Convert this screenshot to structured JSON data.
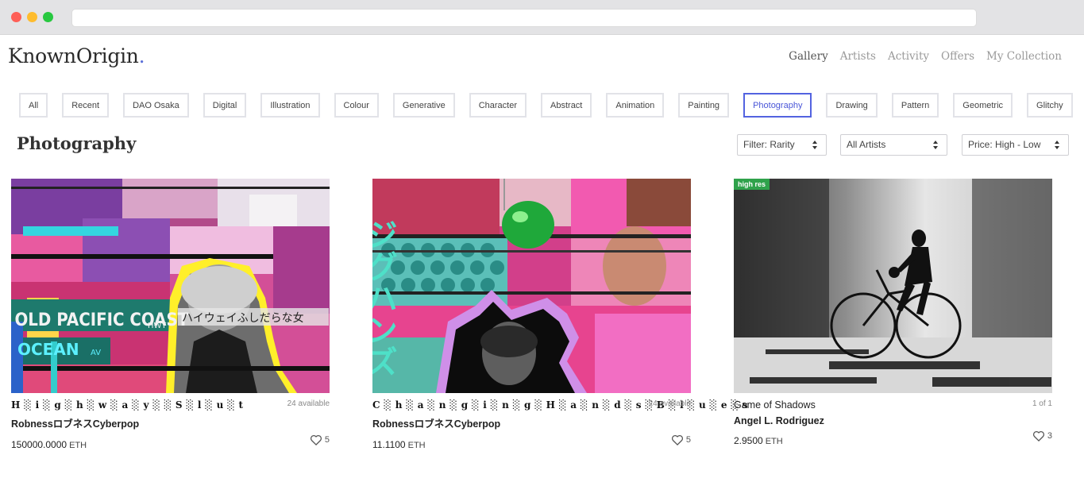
{
  "header": {
    "logo_text": "KnownOrigin",
    "logo_dot": ".",
    "nav": [
      "Gallery",
      "Artists",
      "Activity",
      "Offers",
      "My Collection"
    ],
    "active_nav": "Gallery"
  },
  "categories": [
    "All",
    "Recent",
    "DAO Osaka",
    "Digital",
    "Illustration",
    "Colour",
    "Generative",
    "Character",
    "Abstract",
    "Animation",
    "Painting",
    "Photography",
    "Drawing",
    "Pattern",
    "Geometric",
    "Glitchy",
    ""
  ],
  "active_category": "Photography",
  "section_title": "Photography",
  "filters": {
    "rarity": "Filter: Rarity",
    "artists": "All Artists",
    "price": "Price: High - Low"
  },
  "cards": [
    {
      "title": "H░i░g░h░w░a░y░░S░l░u░t",
      "availability": "24 available",
      "artist": "RobnessロブネスCyberpop",
      "price": "150000.0000",
      "currency": "ETH",
      "likes": "5",
      "art_text": [
        "OLD PACIFIC COAST",
        "HWY",
        "OCEAN",
        "AV",
        "ハイウェイふしだらな女"
      ]
    },
    {
      "title": "C░h░a░n░g░i░n░g░H░a░n░d░s░B░l░u░e░s",
      "availability": "24 available",
      "artist": "RobnessロブネスCyberpop",
      "price": "11.1100",
      "currency": "ETH",
      "likes": "5",
      "art_text": [
        "ジグハンズ"
      ]
    },
    {
      "badge": "high res",
      "title": "Game of Shadows",
      "availability": "1 of 1",
      "artist": "Angel L. Rodriguez",
      "price": "2.9500",
      "currency": "ETH",
      "likes": "3"
    }
  ],
  "colors": {
    "accent": "#5363e0",
    "badge_green": "#2fa24b"
  }
}
